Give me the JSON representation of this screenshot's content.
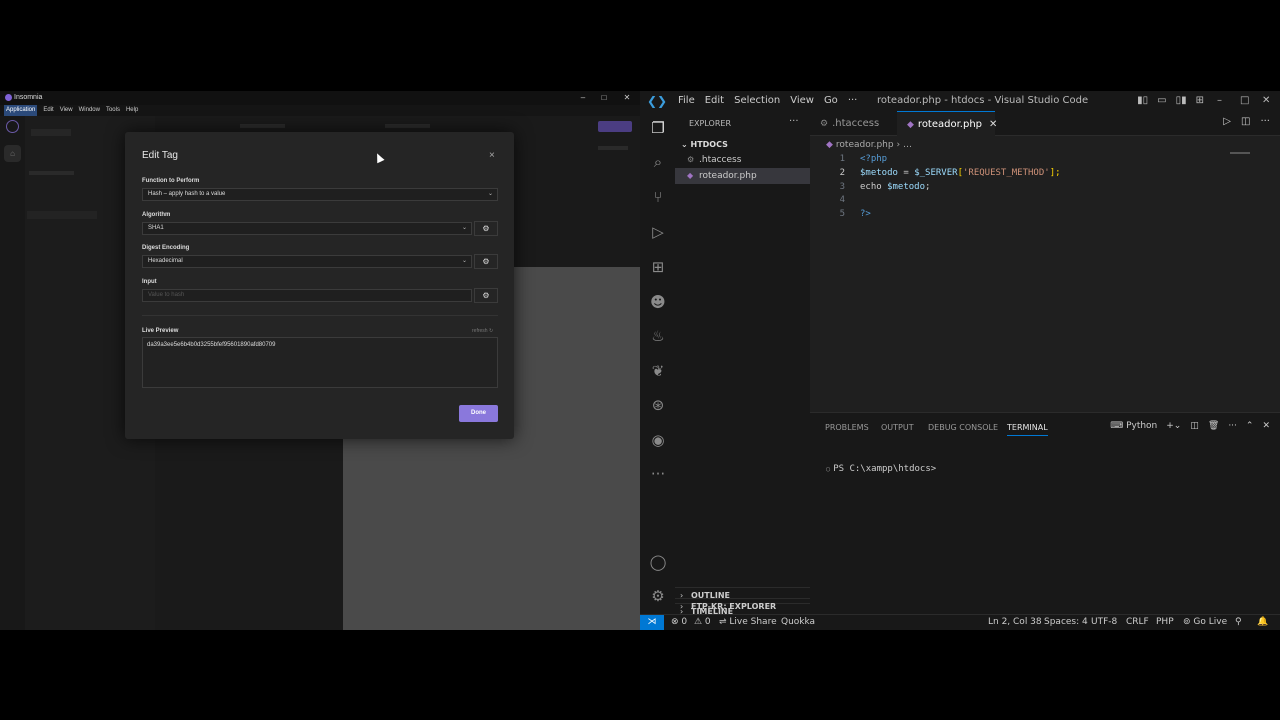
{
  "insomnia": {
    "window_title": "Insomnia",
    "menu": [
      "Application",
      "Edit",
      "View",
      "Window",
      "Tools",
      "Help"
    ],
    "window_controls": [
      "–",
      "□",
      "✕"
    ],
    "rail_icon": "home-icon",
    "modal": {
      "title": "Edit Tag",
      "close": "×",
      "function_label": "Function to Perform",
      "function_value": "Hash – apply hash to a value",
      "algorithm_label": "Algorithm",
      "algorithm_value": "SHA1",
      "encoding_label": "Digest Encoding",
      "encoding_value": "Hexadecimal",
      "input_label": "Input",
      "input_placeholder": "Value to hash",
      "live_label": "Live Preview",
      "refresh_label": "refresh",
      "live_value": "da39a3ee5e6b4b0d3255bfef95601890afd80709",
      "done_label": "Done",
      "accent_color": "#8a78dc"
    }
  },
  "vscode": {
    "menus": [
      "File",
      "Edit",
      "Selection",
      "View",
      "Go",
      "···"
    ],
    "window_title": "roteador.php - htdocs - Visual Studio Code",
    "explorer_header": "EXPLORER",
    "folder": "HTDOCS",
    "files": [
      ".htaccess",
      "roteador.php"
    ],
    "tabs": [
      ".htaccess",
      "roteador.php"
    ],
    "breadcrumb": [
      "roteador.php",
      "…"
    ],
    "code_lines": [
      {
        "n": "1"
      },
      {
        "n": "2"
      },
      {
        "n": "3"
      },
      {
        "n": "4"
      },
      {
        "n": "5"
      }
    ],
    "code": {
      "l1": "<?php",
      "l2_var": "$metodo",
      "l2_eq": " = ",
      "l2_server": "$_SERVER",
      "l2_open": "[",
      "l2_str": "'REQUEST_METHOD'",
      "l2_close": "];",
      "l3_echo": "echo ",
      "l3_var": "$metodo",
      "l3_semi": ";",
      "l5": "?>"
    },
    "sections": [
      "OUTLINE",
      "TIMELINE",
      "FTP-KR: EXPLORER"
    ],
    "panel_tabs": [
      "PROBLEMS",
      "OUTPUT",
      "DEBUG CONSOLE",
      "TERMINAL"
    ],
    "terminal_profile": "Python",
    "terminal_prompt": "PS C:\\xampp\\htdocs>",
    "status": {
      "errors": "⊗ 0",
      "warnings": "⚠ 0",
      "live_share": "Live Share",
      "quokka": "Quokka",
      "position": "Ln 2, Col 38",
      "spaces": "Spaces: 4",
      "encoding": "UTF-8",
      "eol": "CRLF",
      "language": "PHP",
      "go_live": "Go Live"
    },
    "accent_color": "#0078d4"
  }
}
